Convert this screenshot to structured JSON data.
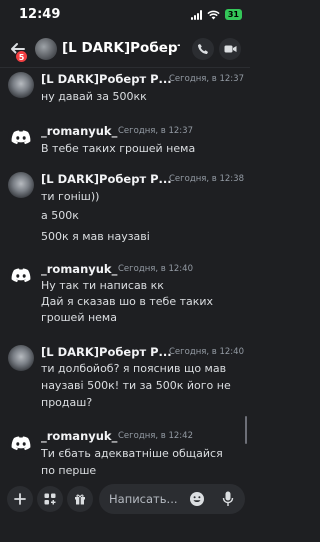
{
  "status": {
    "time": "12:49",
    "battery": "31"
  },
  "header": {
    "unread_badge": "5",
    "title": "[L DARK]Роберт Р..."
  },
  "messages": [
    {
      "author": "[L DARK]Роберт Р...",
      "avatar": "photo",
      "timestamp": "Сегодня, в 12:37",
      "lines": [
        "ну давай за 500кк"
      ]
    },
    {
      "author": "_romanyuk_",
      "avatar": "discord",
      "timestamp": "Сегодня, в 12:37",
      "lines": [
        "В тебе таких грошей нема"
      ]
    },
    {
      "author": "[L DARK]Роберт Р...",
      "avatar": "photo",
      "timestamp": "Сегодня, в 12:38",
      "lines": [
        "ти гоніш))",
        "а 500к",
        "500к я мав наузаві"
      ]
    },
    {
      "author": "_romanyuk_",
      "avatar": "discord",
      "timestamp": "Сегодня, в 12:40",
      "lines": [
        "Ну так ти написав кк",
        "Дай я сказав шо в тебе таких",
        "грошей нема"
      ]
    },
    {
      "author": "[L DARK]Роберт Р...",
      "avatar": "photo",
      "timestamp": "Сегодня, в 12:40",
      "lines": [
        "ти долбойоб? я пояснив що мав",
        "наузаві 500к! ти за 500к його не",
        "продаш?"
      ]
    },
    {
      "author": "_romanyuk_",
      "avatar": "discord",
      "timestamp": "Сегодня, в 12:42",
      "lines": [
        "Ти єбать адекватніше общайся",
        "по перше"
      ]
    }
  ],
  "composer": {
    "placeholder": "Написать..."
  },
  "icons": {
    "back": "arrow-left-icon",
    "voice_call": "phone-icon",
    "video_call": "video-icon",
    "add": "plus-icon",
    "apps": "apps-icon",
    "gift": "gift-icon",
    "emoji": "emoji-icon",
    "mic": "microphone-icon"
  },
  "colors": {
    "background": "#1e1f22",
    "surface": "#2b2d31",
    "badge": "#f23f42",
    "battery": "#34c759",
    "muted_text": "#949ba4"
  }
}
